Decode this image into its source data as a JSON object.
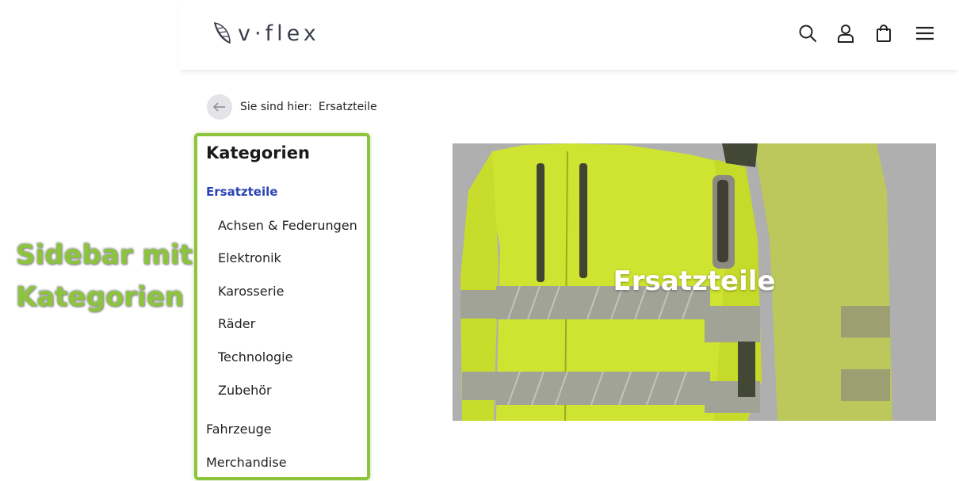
{
  "header": {
    "logo_text": "v·flex",
    "icons": [
      "search-icon",
      "user-icon",
      "bag-icon",
      "menu-icon"
    ]
  },
  "breadcrumb": {
    "label": "Sie sind hier:",
    "current": "Ersatzteile"
  },
  "sidebar": {
    "title": "Kategorien",
    "active": "Ersatzteile",
    "subitems": [
      "Achsen & Federungen",
      "Elektronik",
      "Karosserie",
      "Räder",
      "Technologie",
      "Zubehör"
    ],
    "items": [
      "Fahrzeuge",
      "Merchandise"
    ]
  },
  "annotation": {
    "line1": "Sidebar mit",
    "line2": "Kategorien"
  },
  "hero": {
    "title": "Ersatzteile"
  },
  "colors": {
    "active_link": "#2b45b3",
    "annotation_green": "#8cc43c",
    "hero_overlay": "#b3b3b3",
    "jacket_yellow": "#d6ec2b"
  }
}
